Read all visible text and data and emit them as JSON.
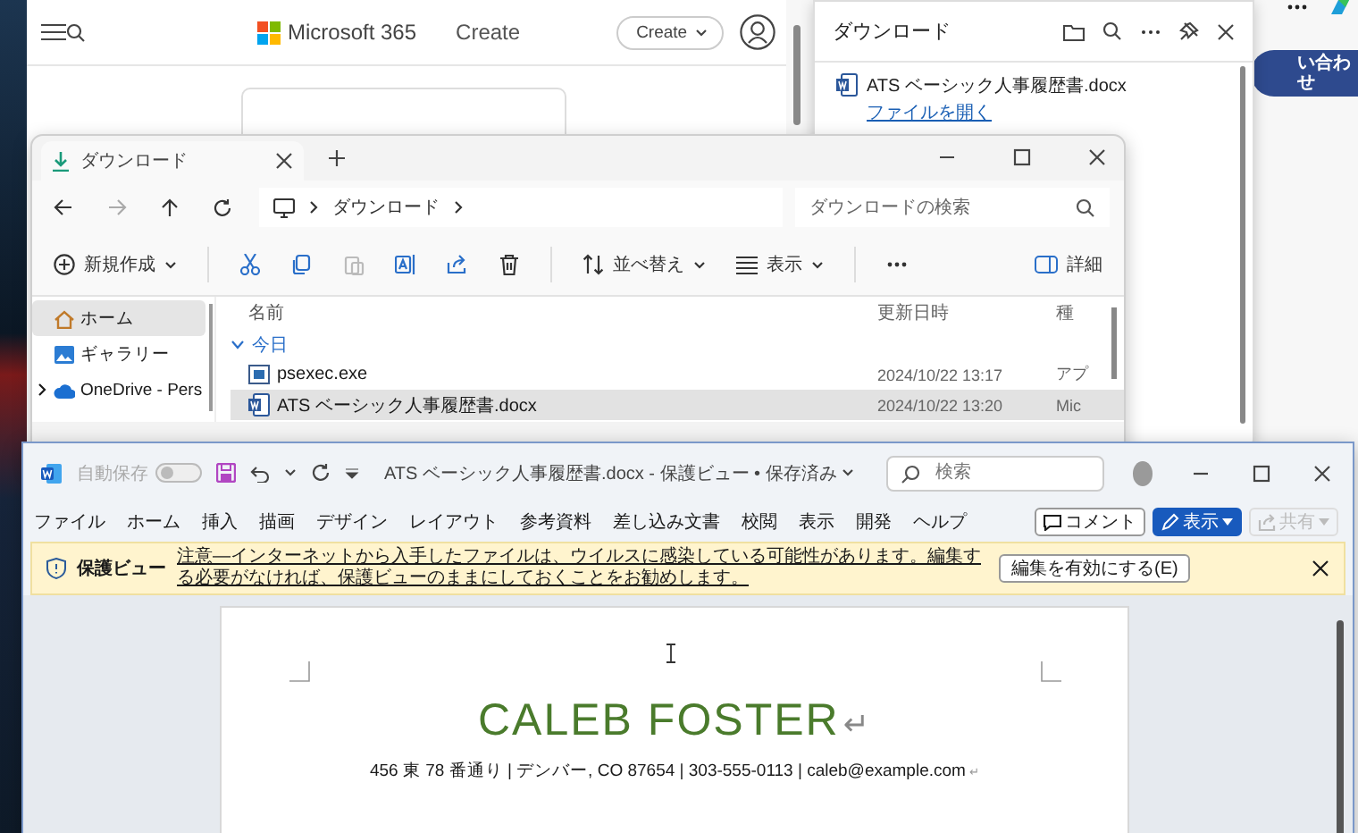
{
  "browser": {
    "brand": "Microsoft 365",
    "page_title": "Create",
    "create_button": "Create",
    "side_button": "い合わせ"
  },
  "downloads_panel": {
    "title": "ダウンロード",
    "items": [
      {
        "name": "ATS ベーシック人事履歴書.docx",
        "action": "ファイルを開く"
      }
    ]
  },
  "explorer": {
    "tab_title": "ダウンロード",
    "breadcrumb": [
      "ダウンロード"
    ],
    "search_placeholder": "ダウンロードの検索",
    "command_groups": [
      [
        {
          "kind": "new",
          "label": "新規作成",
          "disabled": false
        }
      ],
      [
        {
          "kind": "cut",
          "disabled": false
        },
        {
          "kind": "copy",
          "disabled": false
        },
        {
          "kind": "paste",
          "disabled": true
        },
        {
          "kind": "rename",
          "disabled": false
        },
        {
          "kind": "share",
          "disabled": false
        },
        {
          "kind": "delete",
          "disabled": false
        }
      ],
      [
        {
          "kind": "sort",
          "label": "並べ替え",
          "disabled": false
        },
        {
          "kind": "view",
          "label": "表示",
          "disabled": false
        }
      ],
      [
        {
          "kind": "more",
          "disabled": false
        }
      ]
    ],
    "details_button": "詳細",
    "sidebar": [
      {
        "kind": "home",
        "label": "ホーム",
        "selected": true,
        "expandable": false
      },
      {
        "kind": "gallery",
        "label": "ギャラリー",
        "selected": false,
        "expandable": false
      },
      {
        "kind": "cloud",
        "label": "OneDrive - Pers",
        "selected": false,
        "expandable": true
      }
    ],
    "columns": [
      "名前",
      "更新日時",
      "種"
    ],
    "groups": [
      {
        "label": "今日",
        "expanded": true,
        "files": [
          {
            "kind": "exe",
            "name": "psexec.exe",
            "modified": "2024/10/22 13:17",
            "type": "アプ",
            "selected": false
          },
          {
            "kind": "docx",
            "name": "ATS ベーシック人事履歴書.docx",
            "modified": "2024/10/22 13:20",
            "type": "Mic",
            "selected": true
          }
        ]
      }
    ]
  },
  "word": {
    "autosave": {
      "label": "自動保存",
      "on": false
    },
    "title": "ATS ベーシック人事履歴書.docx - 保護ビュー • 保存済み",
    "search_placeholder": "検索",
    "tabs": [
      "ファイル",
      "ホーム",
      "挿入",
      "描画",
      "デザイン",
      "レイアウト",
      "参考資料",
      "差し込み文書",
      "校閲",
      "表示",
      "開発",
      "ヘルプ"
    ],
    "comment_button": "コメント",
    "view_button": "表示",
    "share_button": {
      "label": "共有",
      "disabled": true
    },
    "protected_bar": {
      "title": "保護ビュー",
      "message": "注意—インターネットから入手したファイルは、ウイルスに感染している可能性があります。編集する必要がなければ、保護ビューのままにしておくことをお勧めします。",
      "button": "編集を有効にする(E)"
    },
    "paragraphs": [
      {
        "kind": "name",
        "text": "CALEB FOSTER",
        "mark": "↵"
      },
      {
        "kind": "contact",
        "text": "456 東 78 番通り | デンバー, CO 87654 | 303-555-0113 | caleb@example.com",
        "mark": "↵"
      }
    ]
  }
}
